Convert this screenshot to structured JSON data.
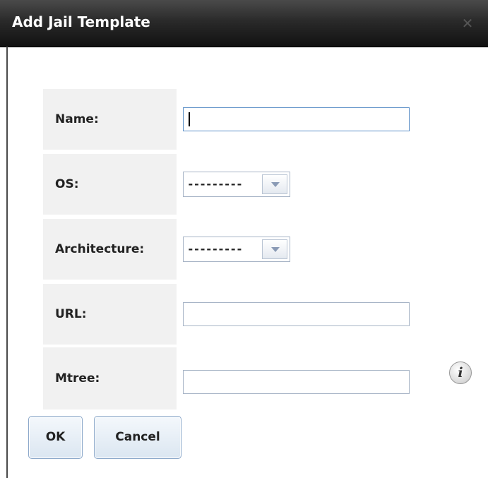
{
  "dialog": {
    "title": "Add Jail Template",
    "close_icon": "close-icon"
  },
  "form": {
    "fields": [
      {
        "label": "Name:",
        "type": "text",
        "value": "",
        "focused": true
      },
      {
        "label": "OS:",
        "type": "select",
        "value": "---------"
      },
      {
        "label": "Architecture:",
        "type": "select",
        "value": "---------"
      },
      {
        "label": "URL:",
        "type": "text",
        "value": ""
      },
      {
        "label": "Mtree:",
        "type": "text",
        "value": "",
        "help_icon": "info-icon"
      }
    ]
  },
  "buttons": {
    "ok_label": "OK",
    "cancel_label": "Cancel"
  },
  "colors": {
    "titlebar": "#111111",
    "label_background": "#f1f1f1",
    "input_border": "#a7b4c6",
    "button_border": "#8aa7c9"
  }
}
